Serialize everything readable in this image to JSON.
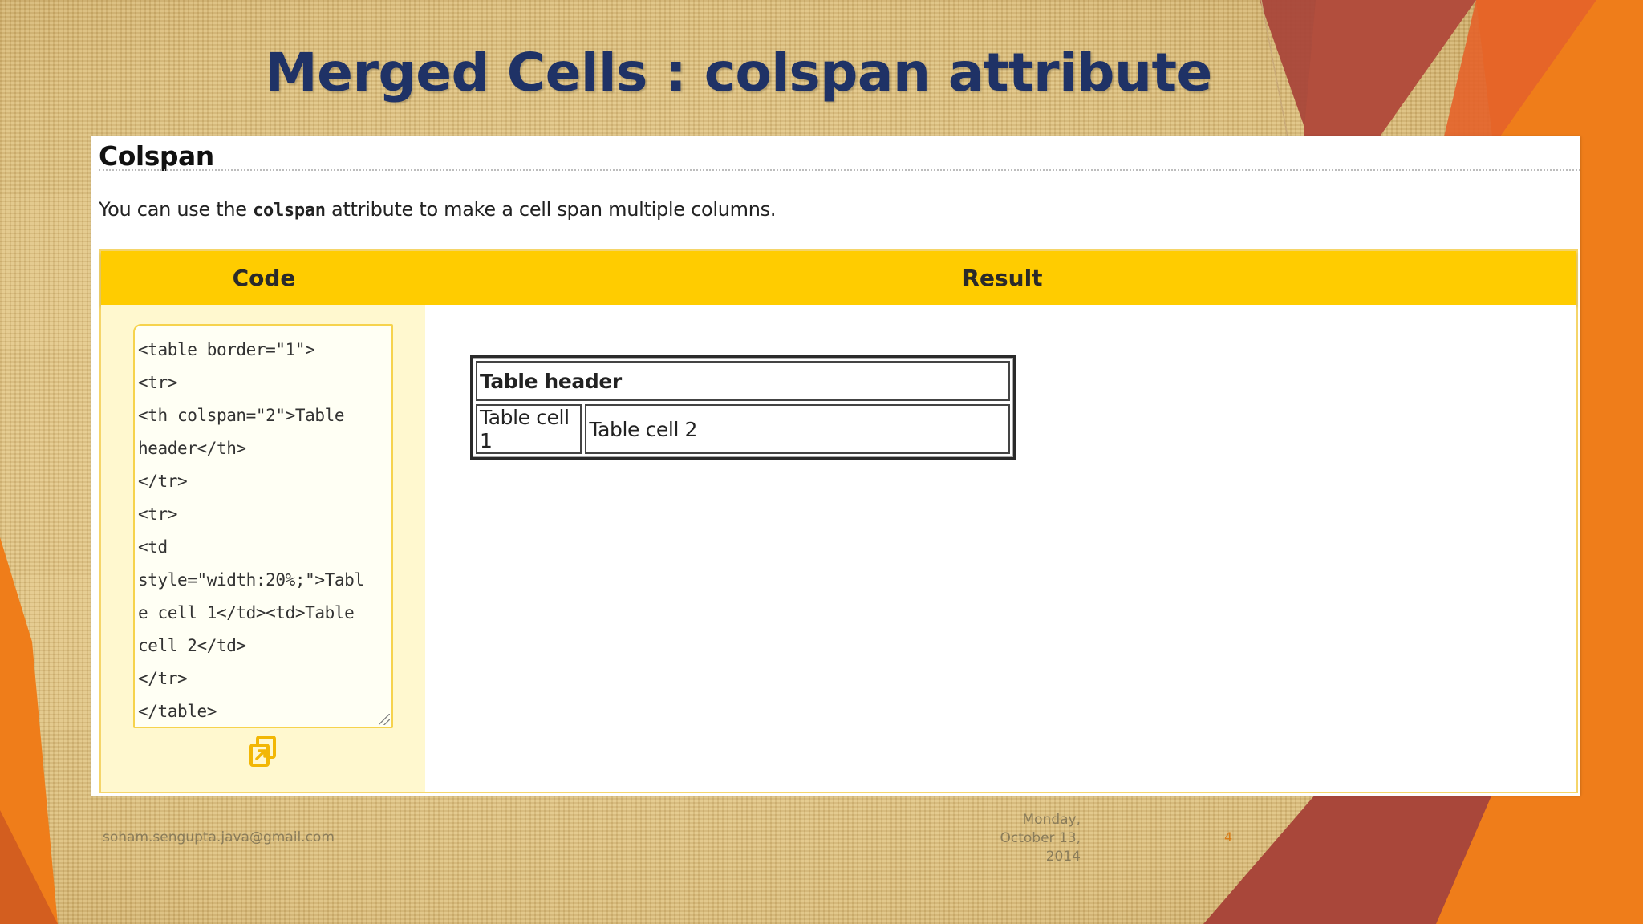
{
  "slide": {
    "title": "Merged Cells : colspan attribute",
    "footer_email": "soham.sengupta.java@gmail.com",
    "footer_date": "Monday,\nOctober 13,\n2014",
    "page_number": "4"
  },
  "panel": {
    "heading": "Colspan",
    "intro_before": "You can use the ",
    "intro_code": "colspan",
    "intro_after": " attribute to make a cell span multiple columns.",
    "example": {
      "code_header": "Code",
      "result_header": "Result",
      "code_lines": [
        "<table border=\"1\">",
        "<tr>",
        "<th colspan=\"2\">Table",
        "header</th>",
        "</tr>",
        "<tr>",
        "<td",
        "style=\"width:20%;\">Tabl",
        "e cell 1</td><td>Table",
        "cell 2</td>",
        "</tr>",
        "</table>"
      ],
      "copy_icon": "copy-icon",
      "result_table": {
        "header": "Table header",
        "cell_1": "Table cell 1",
        "cell_2": "Table cell 2"
      }
    }
  },
  "colors": {
    "title": "#1f3266",
    "header_bar": "#ffcc00",
    "code_bg": "#fff8cf",
    "accent_orange": "#ef7d1a",
    "accent_red": "#a9473a"
  }
}
